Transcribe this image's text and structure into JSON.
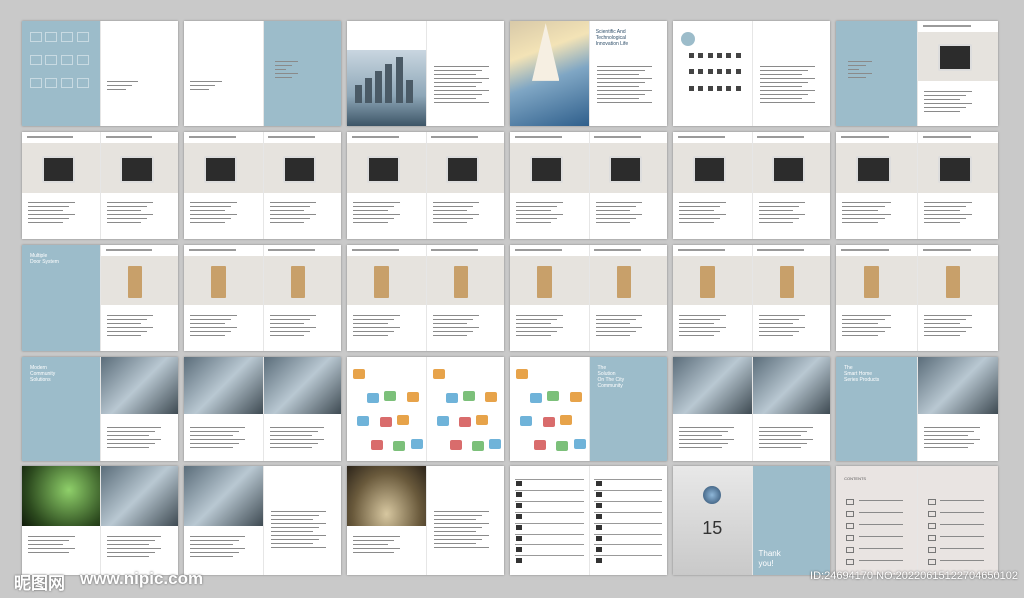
{
  "spreads": [
    {
      "left": {
        "type": "pattern"
      },
      "right": {
        "type": "blank"
      }
    },
    {
      "left": {
        "type": "blank"
      },
      "right": {
        "type": "blue"
      }
    },
    {
      "left": {
        "type": "city"
      },
      "right": {
        "type": "text"
      }
    },
    {
      "left": {
        "type": "sail"
      },
      "right": {
        "type": "text"
      }
    },
    {
      "left": {
        "type": "index"
      },
      "right": {
        "type": "text"
      }
    },
    {
      "left": {
        "type": "blue"
      },
      "right": {
        "type": "device"
      }
    },
    {
      "left": {
        "type": "device"
      },
      "right": {
        "type": "device"
      }
    },
    {
      "left": {
        "type": "device"
      },
      "right": {
        "type": "device"
      }
    },
    {
      "left": {
        "type": "device"
      },
      "right": {
        "type": "device"
      }
    },
    {
      "left": {
        "type": "device"
      },
      "right": {
        "type": "device"
      }
    },
    {
      "left": {
        "type": "device"
      },
      "right": {
        "type": "device"
      }
    },
    {
      "left": {
        "type": "device"
      },
      "right": {
        "type": "device"
      }
    },
    {
      "left": {
        "type": "blue"
      },
      "right": {
        "type": "panel"
      }
    },
    {
      "left": {
        "type": "panel"
      },
      "right": {
        "type": "panel"
      }
    },
    {
      "left": {
        "type": "panel"
      },
      "right": {
        "type": "panel"
      }
    },
    {
      "left": {
        "type": "panel"
      },
      "right": {
        "type": "panel"
      }
    },
    {
      "left": {
        "type": "panel"
      },
      "right": {
        "type": "panel"
      }
    },
    {
      "left": {
        "type": "panel"
      },
      "right": {
        "type": "panel"
      }
    },
    {
      "left": {
        "type": "blue"
      },
      "right": {
        "type": "photo"
      }
    },
    {
      "left": {
        "type": "photo"
      },
      "right": {
        "type": "photo"
      }
    },
    {
      "left": {
        "type": "diagram"
      },
      "right": {
        "type": "diagram"
      }
    },
    {
      "left": {
        "type": "diagram"
      },
      "right": {
        "type": "blue"
      }
    },
    {
      "left": {
        "type": "photo"
      },
      "right": {
        "type": "photo"
      }
    },
    {
      "left": {
        "type": "blue"
      },
      "right": {
        "type": "photo"
      }
    },
    {
      "left": {
        "type": "green"
      },
      "right": {
        "type": "photo"
      }
    },
    {
      "left": {
        "type": "photo"
      },
      "right": {
        "type": "text"
      }
    },
    {
      "left": {
        "type": "dome"
      },
      "right": {
        "type": "text"
      }
    },
    {
      "left": {
        "type": "table"
      },
      "right": {
        "type": "table"
      }
    },
    {
      "left": {
        "type": "fifteen"
      },
      "right": {
        "type": "thanks"
      }
    },
    {
      "left": {
        "type": "contents"
      },
      "right": {
        "type": "contents"
      }
    }
  ],
  "texts": {
    "science_title": "Scientific And\nTechnological\nInnovation Life",
    "multiple_video_title": "Multiple\nVideo Phone",
    "multiple_door_title": "Multiple\nDoor System",
    "community_title": "Modern\nCommunity\nSolutions",
    "solution_title": "The\nSolution\nOn The City\nCommunity",
    "smart_home_title": "The\nSmart Home\nSeries Products",
    "control_title": "Multiple\nControl\nModes",
    "fifteen_text": "15",
    "thanks_text": "Thank\nyou!",
    "contents_title": "CONTENTS"
  },
  "watermark": {
    "logo": "昵图网",
    "url": "www.nipic.com",
    "id_line": "ID:24694170 NO:20220615122704650102"
  },
  "colors": {
    "background": "#c9c9c9",
    "accent_blue": "#9cbcca",
    "device_bg": "#e6e3de"
  }
}
